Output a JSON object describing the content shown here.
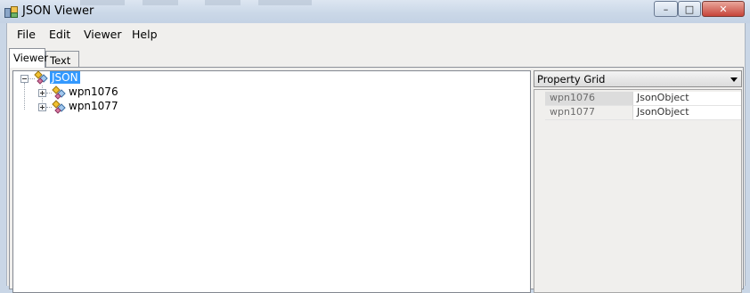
{
  "window": {
    "title": "JSON Viewer",
    "icon": "json-viewer-app-icon",
    "controls": [
      "minimize-icon",
      "maximize-icon",
      "close-icon"
    ]
  },
  "menu": {
    "file": "File",
    "edit": "Edit",
    "viewer": "Viewer",
    "help": "Help"
  },
  "tabs": {
    "viewer": "Viewer",
    "text": "Text"
  },
  "tree": {
    "root": {
      "label": "JSON",
      "icon": "json-node-icon",
      "expanded": true,
      "selected": true
    },
    "children": [
      {
        "label": "wpn1076",
        "icon": "json-object-icon",
        "expanded": false
      },
      {
        "label": "wpn1077",
        "icon": "json-object-icon",
        "expanded": false
      }
    ]
  },
  "property_grid": {
    "header": "Property Grid",
    "rows": [
      {
        "name": "wpn1076",
        "value": "JsonObject",
        "selected": true
      },
      {
        "name": "wpn1077",
        "value": "JsonObject",
        "selected": false
      }
    ]
  },
  "colors": {
    "selection": "#3399ff",
    "titlebar": "#cbd8e8",
    "surface": "#f0efed"
  }
}
